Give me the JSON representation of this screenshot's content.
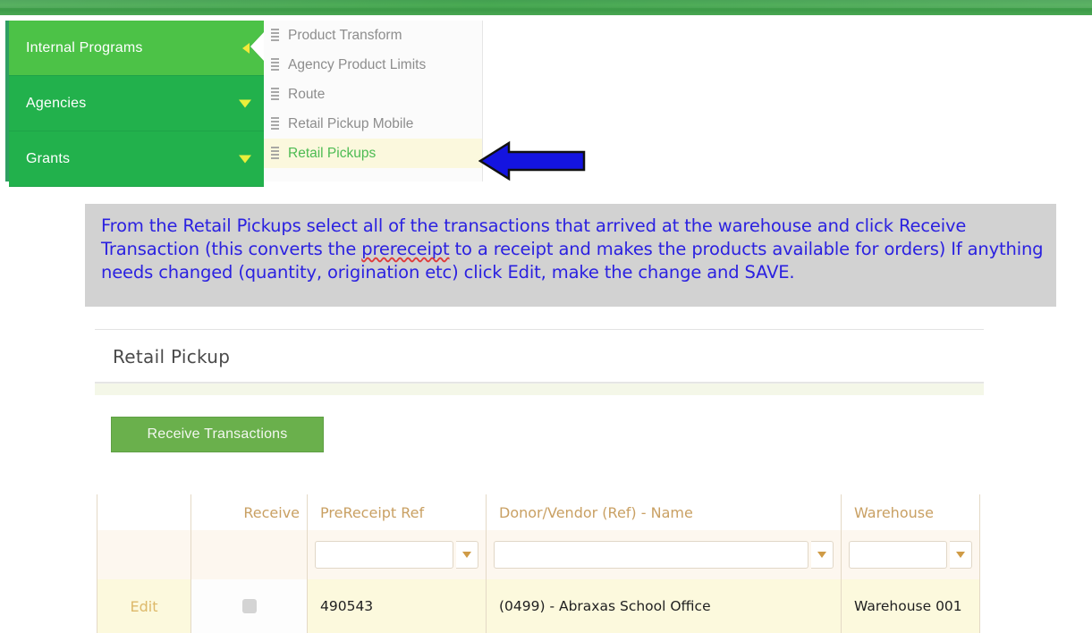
{
  "topbar": {
    "label": "top-green-band"
  },
  "nav": {
    "items": [
      {
        "label": "Internal Programs",
        "state": "active",
        "icon": "caret-left-icon"
      },
      {
        "label": "Agencies",
        "state": "normal",
        "icon": "caret-down-icon"
      },
      {
        "label": "Grants",
        "state": "normal",
        "icon": "caret-down-icon"
      }
    ]
  },
  "submenu": {
    "items": [
      {
        "label": "Product Transform",
        "highlight": false,
        "icon": "grip-handle-icon"
      },
      {
        "label": "Agency Product Limits",
        "highlight": false,
        "icon": "grip-handle-icon"
      },
      {
        "label": "Route",
        "highlight": false,
        "icon": "grip-handle-icon"
      },
      {
        "label": "Retail Pickup Mobile",
        "highlight": false,
        "icon": "grip-handle-icon"
      },
      {
        "label": "Retail Pickups",
        "highlight": true,
        "icon": "grip-handle-icon"
      }
    ]
  },
  "annotation": {
    "arrow": "left-pointing-arrow",
    "arrow_color": "#1414e0",
    "arrow_border": "#000000"
  },
  "instructions": {
    "line1_a": "From the Retail Pickups select all of the transactions that arrived at the warehouse and click Receive Transaction (this converts the ",
    "misspelled_word": "prereceipt",
    "line1_b": " to a receipt and makes the products available for orders)  If anything needs changed (quantity, origination etc)  click Edit, make the change and SAVE.",
    "text_color": "#2b21e0",
    "box_color": "#d2d2d2"
  },
  "panel": {
    "title": "Retail Pickup",
    "receive_button": "Receive Transactions",
    "button_color": "#6ab04c"
  },
  "grid": {
    "headers": [
      "",
      "Receive",
      "PreReceipt Ref",
      "Donor/Vendor (Ref) - Name",
      "Warehouse"
    ],
    "header_color": "#c9a063",
    "filters": [
      {
        "value": "",
        "has_dropdown": false
      },
      {
        "value": "",
        "has_dropdown": false
      },
      {
        "value": "",
        "has_dropdown": true
      },
      {
        "value": "",
        "has_dropdown": true
      },
      {
        "value": "",
        "has_dropdown": true
      }
    ],
    "rows": [
      {
        "edit_label": "Edit",
        "receive_checked": false,
        "prereceipt_ref": "490543",
        "donor_vendor": "(0499) - Abraxas School Office",
        "warehouse": "Warehouse 001"
      }
    ]
  }
}
